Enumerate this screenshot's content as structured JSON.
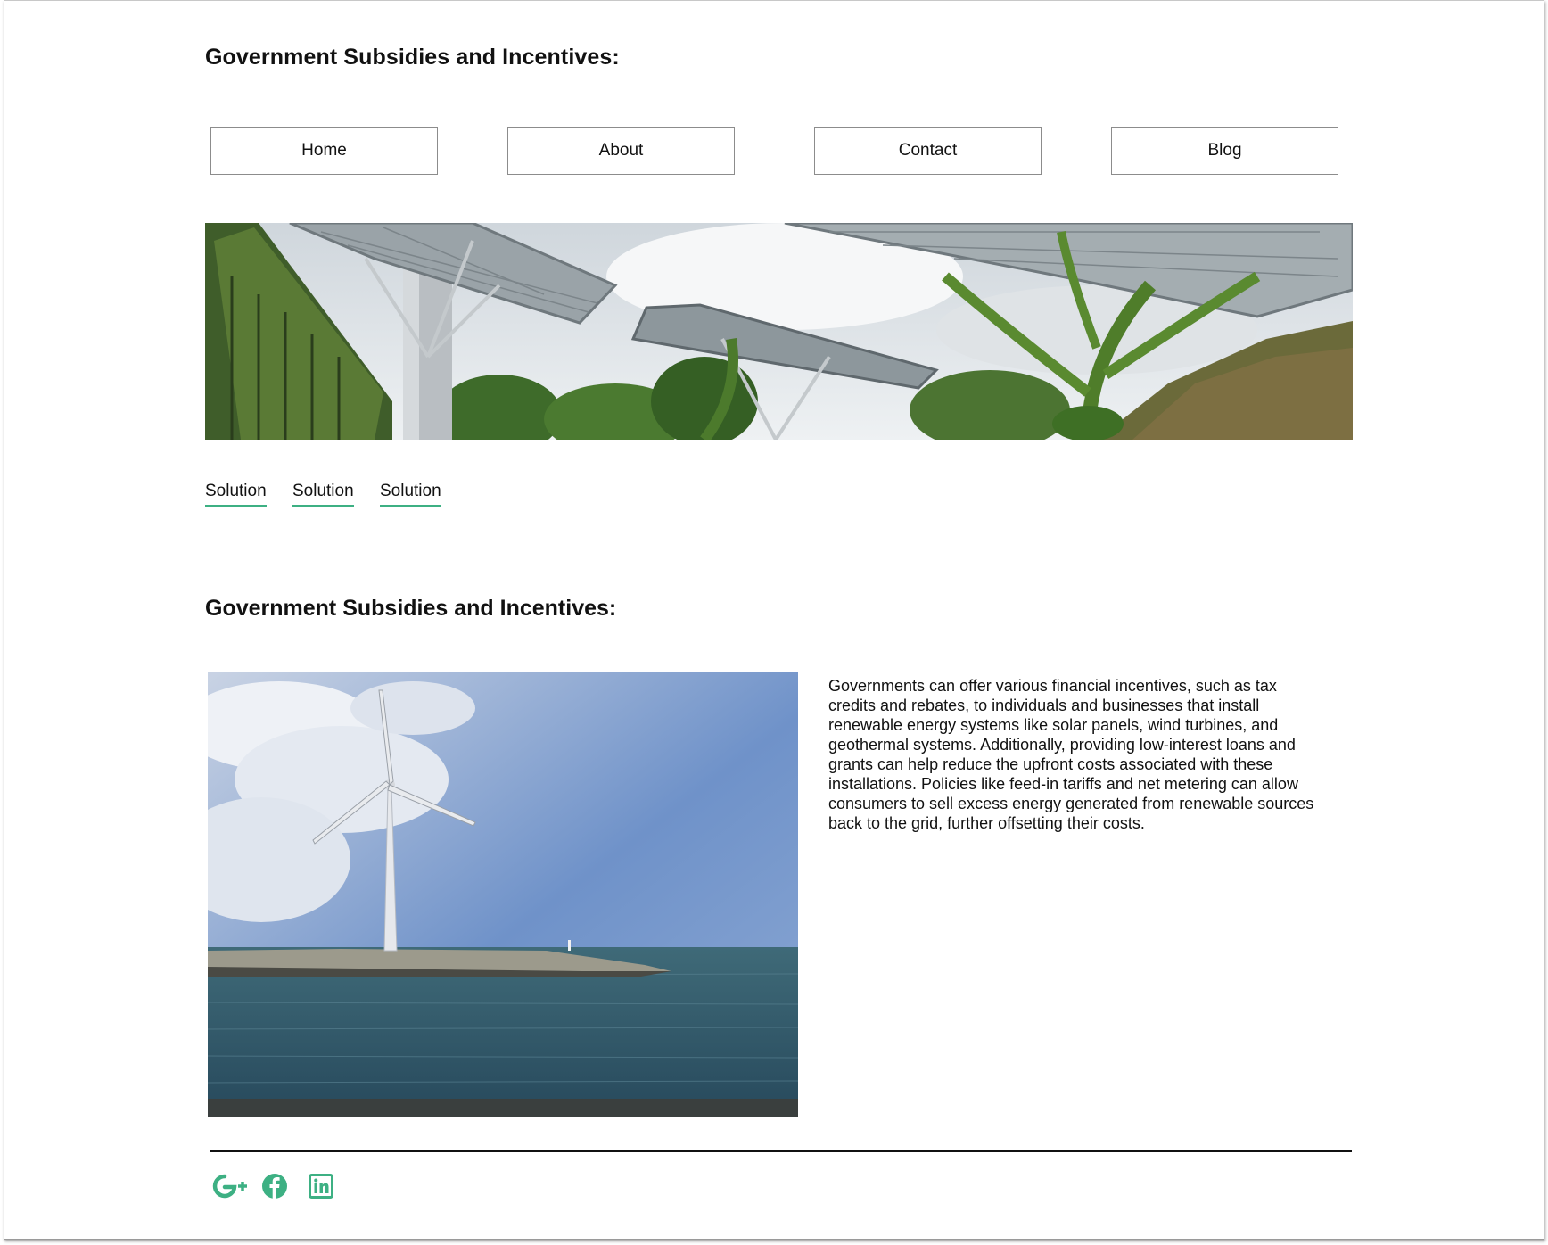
{
  "header": {
    "title": "Government Subsidies and Incentives:"
  },
  "nav": {
    "items": [
      {
        "label": "Home"
      },
      {
        "label": "About"
      },
      {
        "label": "Contact"
      },
      {
        "label": "Blog"
      }
    ]
  },
  "hero": {
    "image": "solar-tree-canopy-photo"
  },
  "tabs": [
    {
      "label": "Solution"
    },
    {
      "label": "Solution"
    },
    {
      "label": "Solution"
    }
  ],
  "section": {
    "title": "Government Subsidies and Incentives:",
    "image": "wind-turbine-photo",
    "body": "Governments can offer various financial incentives, such as tax credits and rebates, to individuals and businesses that install renewable energy systems like solar panels, wind turbines, and geothermal systems. Additionally, providing low-interest loans and grants can help reduce the upfront costs associated with these installations. Policies like feed-in tariffs and net metering can allow consumers to sell excess energy generated from renewable sources back to the grid, further offsetting their costs."
  },
  "footer": {
    "social": [
      {
        "icon": "google-plus-icon"
      },
      {
        "icon": "facebook-icon"
      },
      {
        "icon": "linkedin-icon"
      }
    ]
  },
  "colors": {
    "accent": "#3db083",
    "border": "#8c8c8c",
    "text": "#111111"
  }
}
